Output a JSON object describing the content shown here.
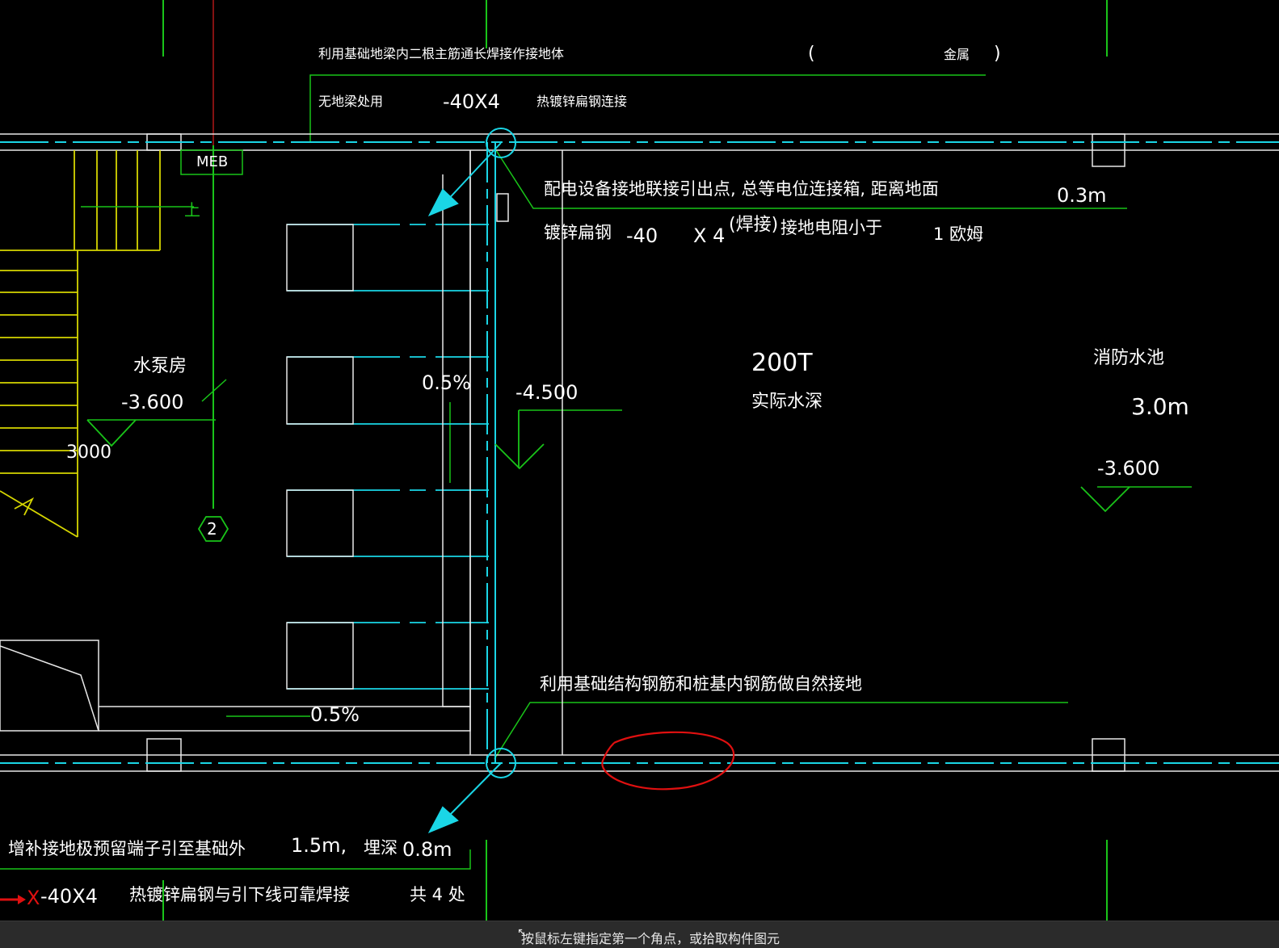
{
  "texts": {
    "top_note": "利用基础地梁内二根主筋通长焊接作接地体",
    "paren_open": "(",
    "paren_word": "金属",
    "paren_close": ")",
    "no_beam_use": "无地梁处用",
    "flat_steel_top": "-40X4",
    "hot_dip_link": "热镀锌扁钢连接",
    "meb": "MEB",
    "up_label": "上",
    "pump_room": "水泵房",
    "pump_level": "-3.600",
    "dim_3000": "3000",
    "axis_2": "2",
    "slope_mid": "0.5%",
    "slope_bottom": "0.5%",
    "level_mid": "-4.500",
    "power_eq_note": "配电设备接地联接引出点, 总等电位连接箱, 距离地面",
    "height_03": "0.3m",
    "galv_flat": "镀锌扁钢",
    "dim_40": "-40",
    "x4": "X 4",
    "welded": "(焊接)",
    "ground_res": "接地电阻小于",
    "one_ohm": "1 欧姆",
    "cap_200t": "200T",
    "actual_depth": "实际水深",
    "fire_pool": "消防水池",
    "depth_3m": "3.0m",
    "pool_level": "-3.600",
    "natural_ground": "利用基础结构钢筋和桩基内钢筋做自然接地",
    "add_terminal": "增补接地极预留端子引至基础外",
    "dist_15": "1.5m,",
    "buried": "埋深",
    "depth_08": "0.8m",
    "x_mark": "X",
    "flat_bottom": "-40X4",
    "hot_dip_weld": "热镀锌扁钢与引下线可靠焊接",
    "total_four": "共 4 处"
  },
  "status": {
    "prompt": "按鼠标左键指定第一个角点，或拾取构件图元"
  },
  "colors": {
    "background": "#000000",
    "green": "#19c419",
    "cyan": "#1ad6e6",
    "white": "#e8e8e8",
    "yellow": "#d6d600",
    "red": "#e01010"
  }
}
